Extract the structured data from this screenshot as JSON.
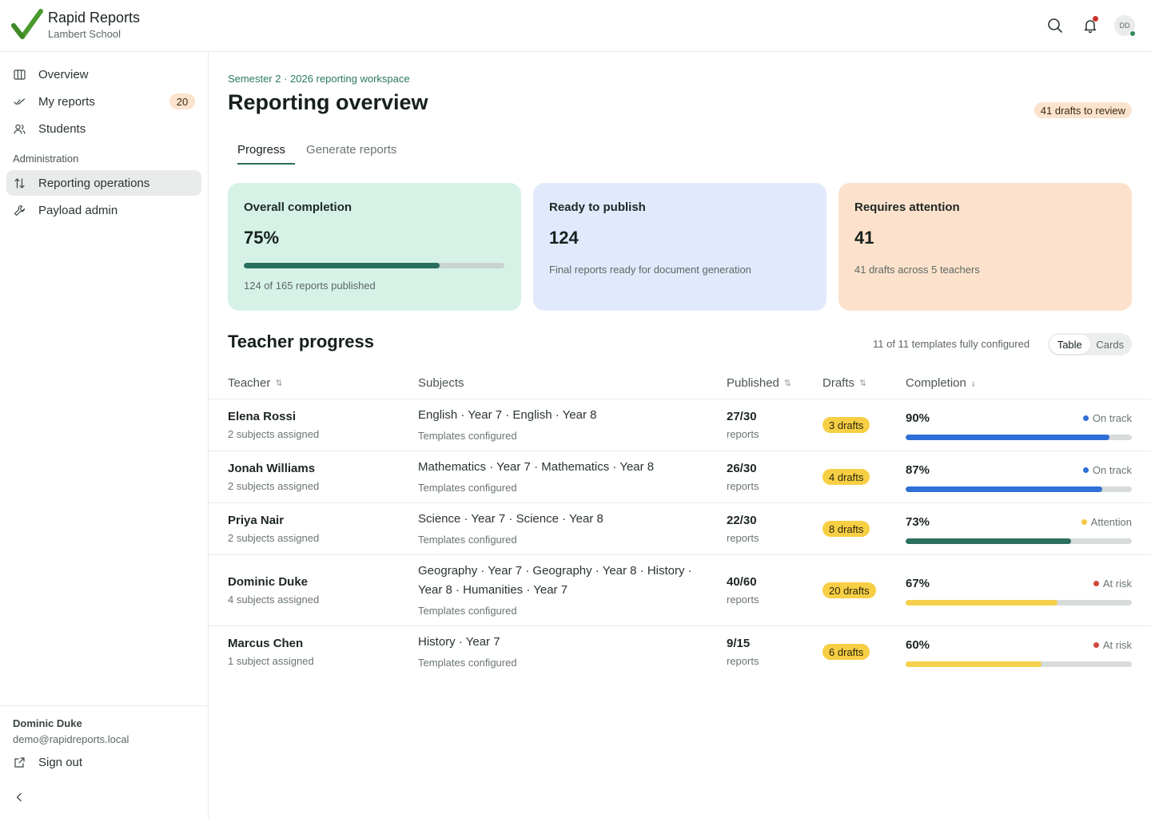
{
  "app": {
    "name": "Rapid Reports",
    "school": "Lambert School",
    "avatar_initials": "DD",
    "brand_color": "#4a9a2e"
  },
  "sidebar": {
    "items": [
      {
        "label": "Overview",
        "icon": "columns-icon"
      },
      {
        "label": "My reports",
        "icon": "double-check-icon",
        "badge": "20"
      },
      {
        "label": "Students",
        "icon": "users-icon"
      }
    ],
    "section_label": "Administration",
    "admin_items": [
      {
        "label": "Reporting operations",
        "icon": "arrows-up-down-icon",
        "active": true
      },
      {
        "label": "Payload admin",
        "icon": "wrench-icon"
      }
    ],
    "user": {
      "name": "Dominic Duke",
      "email": "demo@rapidreports.local"
    },
    "sign_out_label": "Sign out"
  },
  "main": {
    "eyebrow": "Semester 2 · 2026 reporting workspace",
    "title": "Reporting overview",
    "review_badge": "41 drafts to review",
    "tabs": [
      {
        "label": "Progress",
        "active": true
      },
      {
        "label": "Generate reports",
        "active": false
      }
    ],
    "stats": [
      {
        "title": "Overall completion",
        "value": "75%",
        "progress": 0.75,
        "note": "124 of 165 reports published",
        "color": "#d6f2e7"
      },
      {
        "title": "Ready to publish",
        "value": "124",
        "note": "Final reports ready for document generation",
        "color": "#e1e9fc"
      },
      {
        "title": "Requires attention",
        "value": "41",
        "note": "41 drafts across 5 teachers",
        "color": "#fce2cc"
      }
    ],
    "section_title": "Teacher progress",
    "config_note": "11 of 11 templates fully configured",
    "view_toggle": {
      "options": [
        "Table",
        "Cards"
      ],
      "selected": "Table"
    },
    "table": {
      "headers": {
        "teacher": "Teacher",
        "subjects": "Subjects",
        "published": "Published",
        "drafts": "Drafts",
        "completion": "Completion"
      },
      "rows": [
        {
          "name": "Elena Rossi",
          "assigned": "2 subjects assigned",
          "subjects": "English · Year 7 · English · Year 8",
          "templates": "Templates configured",
          "published": "27/30",
          "unit": "reports",
          "drafts": "3 drafts",
          "completion": "90%",
          "progress": 0.9,
          "status": "On track",
          "status_color": "#2f6fd6",
          "bar_color": "#2f6fd6"
        },
        {
          "name": "Jonah Williams",
          "assigned": "2 subjects assigned",
          "subjects": "Mathematics · Year 7 · Mathematics · Year 8",
          "templates": "Templates configured",
          "published": "26/30",
          "unit": "reports",
          "drafts": "4 drafts",
          "completion": "87%",
          "progress": 0.87,
          "status": "On track",
          "status_color": "#2f6fd6",
          "bar_color": "#2f6fd6"
        },
        {
          "name": "Priya Nair",
          "assigned": "2 subjects assigned",
          "subjects": "Science · Year 7 · Science · Year 8",
          "templates": "Templates configured",
          "published": "22/30",
          "unit": "reports",
          "drafts": "8 drafts",
          "completion": "73%",
          "progress": 0.73,
          "status": "Attention",
          "status_color": "#f2c744",
          "bar_color": "#2a6e5e"
        },
        {
          "name": "Dominic Duke",
          "assigned": "4 subjects assigned",
          "subjects": "Geography · Year 7 · Geography · Year 8 · History · Year 8 · Humanities · Year 7",
          "templates": "Templates configured",
          "published": "40/60",
          "unit": "reports",
          "drafts": "20 drafts",
          "completion": "67%",
          "progress": 0.67,
          "status": "At risk",
          "status_color": "#d24a3f",
          "bar_color": "#f5d04a"
        },
        {
          "name": "Marcus Chen",
          "assigned": "1 subject assigned",
          "subjects": "History · Year 7",
          "templates": "Templates configured",
          "published": "9/15",
          "unit": "reports",
          "drafts": "6 drafts",
          "completion": "60%",
          "progress": 0.6,
          "status": "At risk",
          "status_color": "#d24a3f",
          "bar_color": "#f5d04a"
        }
      ]
    }
  }
}
